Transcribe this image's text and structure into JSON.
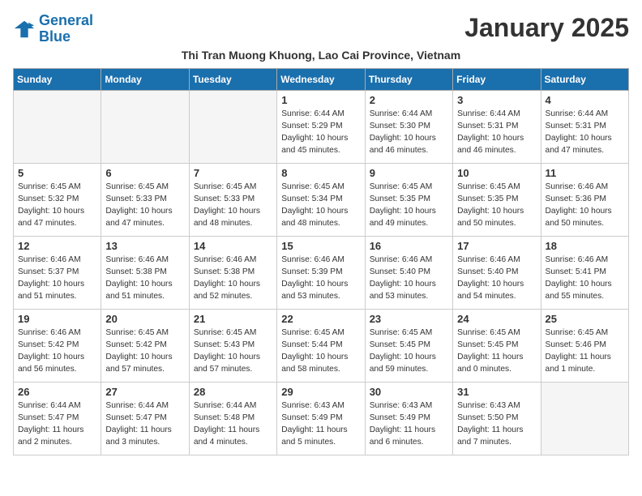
{
  "logo": {
    "line1": "General",
    "line2": "Blue"
  },
  "title": "January 2025",
  "subtitle": "Thi Tran Muong Khuong, Lao Cai Province, Vietnam",
  "days_of_week": [
    "Sunday",
    "Monday",
    "Tuesday",
    "Wednesday",
    "Thursday",
    "Friday",
    "Saturday"
  ],
  "weeks": [
    [
      {
        "day": "",
        "info": ""
      },
      {
        "day": "",
        "info": ""
      },
      {
        "day": "",
        "info": ""
      },
      {
        "day": "1",
        "info": "Sunrise: 6:44 AM\nSunset: 5:29 PM\nDaylight: 10 hours\nand 45 minutes."
      },
      {
        "day": "2",
        "info": "Sunrise: 6:44 AM\nSunset: 5:30 PM\nDaylight: 10 hours\nand 46 minutes."
      },
      {
        "day": "3",
        "info": "Sunrise: 6:44 AM\nSunset: 5:31 PM\nDaylight: 10 hours\nand 46 minutes."
      },
      {
        "day": "4",
        "info": "Sunrise: 6:44 AM\nSunset: 5:31 PM\nDaylight: 10 hours\nand 47 minutes."
      }
    ],
    [
      {
        "day": "5",
        "info": "Sunrise: 6:45 AM\nSunset: 5:32 PM\nDaylight: 10 hours\nand 47 minutes."
      },
      {
        "day": "6",
        "info": "Sunrise: 6:45 AM\nSunset: 5:33 PM\nDaylight: 10 hours\nand 47 minutes."
      },
      {
        "day": "7",
        "info": "Sunrise: 6:45 AM\nSunset: 5:33 PM\nDaylight: 10 hours\nand 48 minutes."
      },
      {
        "day": "8",
        "info": "Sunrise: 6:45 AM\nSunset: 5:34 PM\nDaylight: 10 hours\nand 48 minutes."
      },
      {
        "day": "9",
        "info": "Sunrise: 6:45 AM\nSunset: 5:35 PM\nDaylight: 10 hours\nand 49 minutes."
      },
      {
        "day": "10",
        "info": "Sunrise: 6:45 AM\nSunset: 5:35 PM\nDaylight: 10 hours\nand 50 minutes."
      },
      {
        "day": "11",
        "info": "Sunrise: 6:46 AM\nSunset: 5:36 PM\nDaylight: 10 hours\nand 50 minutes."
      }
    ],
    [
      {
        "day": "12",
        "info": "Sunrise: 6:46 AM\nSunset: 5:37 PM\nDaylight: 10 hours\nand 51 minutes."
      },
      {
        "day": "13",
        "info": "Sunrise: 6:46 AM\nSunset: 5:38 PM\nDaylight: 10 hours\nand 51 minutes."
      },
      {
        "day": "14",
        "info": "Sunrise: 6:46 AM\nSunset: 5:38 PM\nDaylight: 10 hours\nand 52 minutes."
      },
      {
        "day": "15",
        "info": "Sunrise: 6:46 AM\nSunset: 5:39 PM\nDaylight: 10 hours\nand 53 minutes."
      },
      {
        "day": "16",
        "info": "Sunrise: 6:46 AM\nSunset: 5:40 PM\nDaylight: 10 hours\nand 53 minutes."
      },
      {
        "day": "17",
        "info": "Sunrise: 6:46 AM\nSunset: 5:40 PM\nDaylight: 10 hours\nand 54 minutes."
      },
      {
        "day": "18",
        "info": "Sunrise: 6:46 AM\nSunset: 5:41 PM\nDaylight: 10 hours\nand 55 minutes."
      }
    ],
    [
      {
        "day": "19",
        "info": "Sunrise: 6:46 AM\nSunset: 5:42 PM\nDaylight: 10 hours\nand 56 minutes."
      },
      {
        "day": "20",
        "info": "Sunrise: 6:45 AM\nSunset: 5:42 PM\nDaylight: 10 hours\nand 57 minutes."
      },
      {
        "day": "21",
        "info": "Sunrise: 6:45 AM\nSunset: 5:43 PM\nDaylight: 10 hours\nand 57 minutes."
      },
      {
        "day": "22",
        "info": "Sunrise: 6:45 AM\nSunset: 5:44 PM\nDaylight: 10 hours\nand 58 minutes."
      },
      {
        "day": "23",
        "info": "Sunrise: 6:45 AM\nSunset: 5:45 PM\nDaylight: 10 hours\nand 59 minutes."
      },
      {
        "day": "24",
        "info": "Sunrise: 6:45 AM\nSunset: 5:45 PM\nDaylight: 11 hours\nand 0 minutes."
      },
      {
        "day": "25",
        "info": "Sunrise: 6:45 AM\nSunset: 5:46 PM\nDaylight: 11 hours\nand 1 minute."
      }
    ],
    [
      {
        "day": "26",
        "info": "Sunrise: 6:44 AM\nSunset: 5:47 PM\nDaylight: 11 hours\nand 2 minutes."
      },
      {
        "day": "27",
        "info": "Sunrise: 6:44 AM\nSunset: 5:47 PM\nDaylight: 11 hours\nand 3 minutes."
      },
      {
        "day": "28",
        "info": "Sunrise: 6:44 AM\nSunset: 5:48 PM\nDaylight: 11 hours\nand 4 minutes."
      },
      {
        "day": "29",
        "info": "Sunrise: 6:43 AM\nSunset: 5:49 PM\nDaylight: 11 hours\nand 5 minutes."
      },
      {
        "day": "30",
        "info": "Sunrise: 6:43 AM\nSunset: 5:49 PM\nDaylight: 11 hours\nand 6 minutes."
      },
      {
        "day": "31",
        "info": "Sunrise: 6:43 AM\nSunset: 5:50 PM\nDaylight: 11 hours\nand 7 minutes."
      },
      {
        "day": "",
        "info": ""
      }
    ]
  ]
}
